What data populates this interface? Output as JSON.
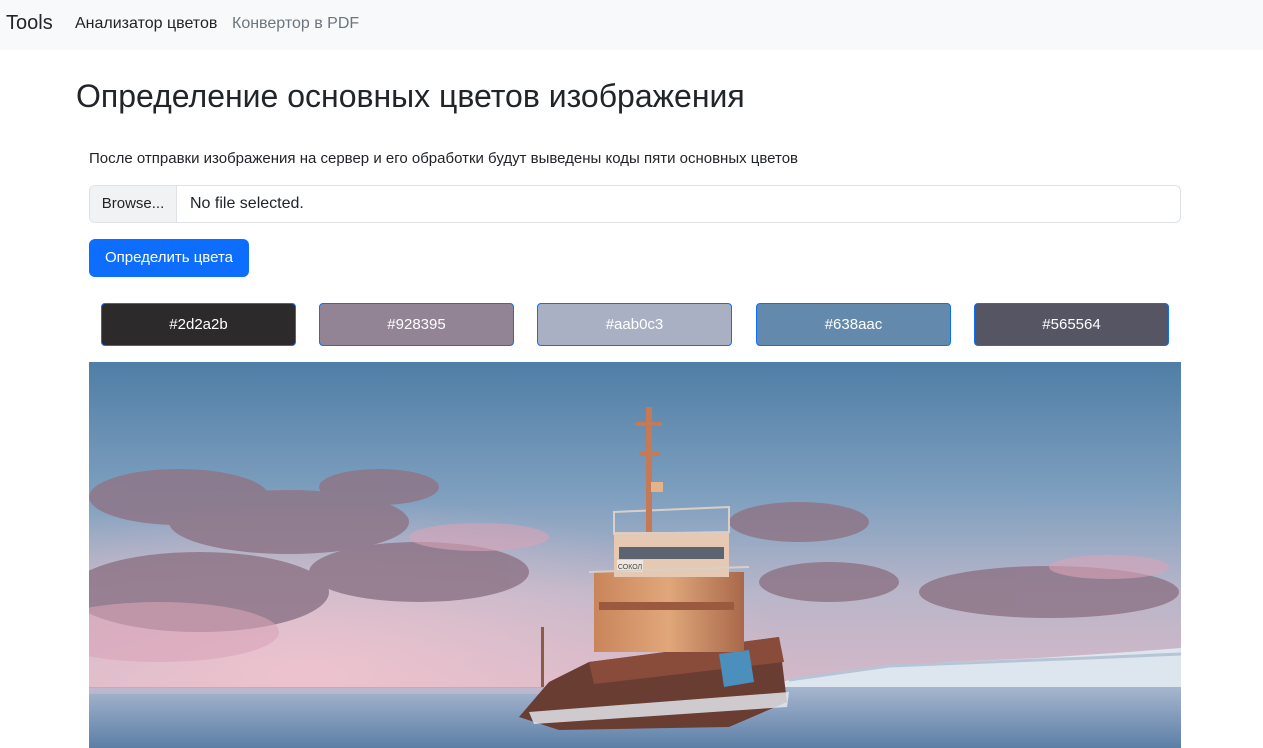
{
  "nav": {
    "brand": "Tools",
    "links": [
      {
        "label": "Анализатор цветов",
        "active": true
      },
      {
        "label": "Конвертор в PDF",
        "active": false
      }
    ]
  },
  "main": {
    "title": "Определение основных цветов изображения",
    "description": "После отправки изображения на сервер и его обработки будут выведены коды пяти основных цветов",
    "file_input": {
      "button_label": "Browse...",
      "status": "No file selected."
    },
    "submit_label": "Определить цвета",
    "swatches": [
      "#2d2a2b",
      "#928395",
      "#aab0c3",
      "#638aac",
      "#565564"
    ],
    "image": {
      "ship_name": "СОКОЛ"
    }
  }
}
